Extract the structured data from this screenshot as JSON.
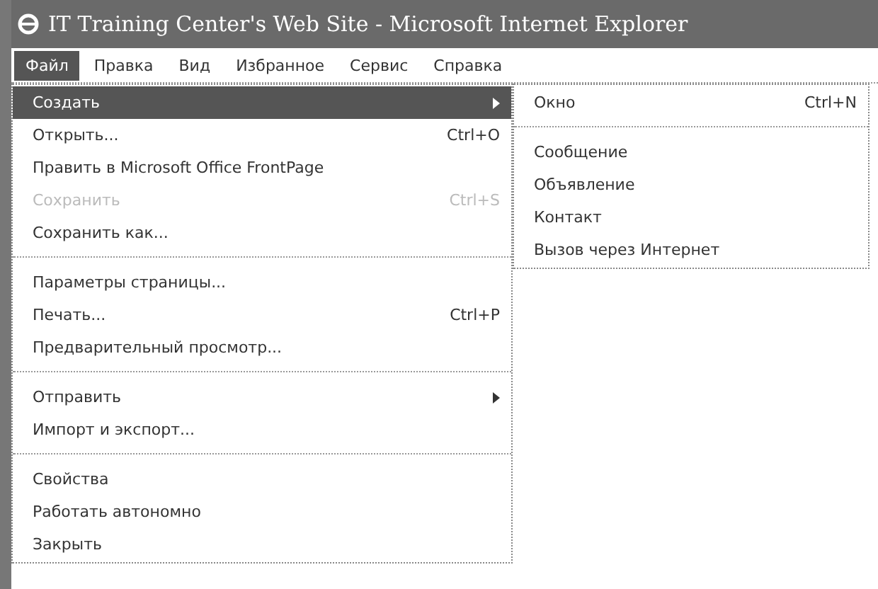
{
  "window": {
    "title": "IT Training Center's Web Site - Microsoft Internet Explorer"
  },
  "menu_bar": [
    {
      "label": "Файл",
      "selected": true
    },
    {
      "label": "Правка",
      "selected": false
    },
    {
      "label": "Вид",
      "selected": false
    },
    {
      "label": "Избранное",
      "selected": false
    },
    {
      "label": "Сервис",
      "selected": false
    },
    {
      "label": "Справка",
      "selected": false
    }
  ],
  "file_menu": [
    {
      "kind": "item",
      "label": "Создать",
      "selected": true,
      "disabled": false,
      "submenu": true
    },
    {
      "kind": "item",
      "label": "Открыть...",
      "shortcut": "Ctrl+O",
      "selected": false,
      "disabled": false,
      "submenu": false
    },
    {
      "kind": "item",
      "label": "Править в Microsoft Office FrontPage",
      "selected": false,
      "disabled": false,
      "submenu": false
    },
    {
      "kind": "item",
      "label": "Сохранить",
      "shortcut": "Ctrl+S",
      "selected": false,
      "disabled": true,
      "submenu": false
    },
    {
      "kind": "item",
      "label": "Сохранить как...",
      "selected": false,
      "disabled": false,
      "submenu": false
    },
    {
      "kind": "separator"
    },
    {
      "kind": "item",
      "label": "Параметры страницы...",
      "selected": false,
      "disabled": false,
      "submenu": false
    },
    {
      "kind": "item",
      "label": "Печать...",
      "shortcut": "Ctrl+P",
      "selected": false,
      "disabled": false,
      "submenu": false
    },
    {
      "kind": "item",
      "label": "Предварительный просмотр...",
      "selected": false,
      "disabled": false,
      "submenu": false
    },
    {
      "kind": "separator"
    },
    {
      "kind": "item",
      "label": "Отправить",
      "selected": false,
      "disabled": false,
      "submenu": true
    },
    {
      "kind": "item",
      "label": "Импорт и экспорт...",
      "selected": false,
      "disabled": false,
      "submenu": false
    },
    {
      "kind": "separator"
    },
    {
      "kind": "item",
      "label": "Свойства",
      "selected": false,
      "disabled": false,
      "submenu": false
    },
    {
      "kind": "item",
      "label": "Работать автономно",
      "selected": false,
      "disabled": false,
      "submenu": false
    },
    {
      "kind": "item",
      "label": "Закрыть",
      "selected": false,
      "disabled": false,
      "submenu": false
    }
  ],
  "new_submenu": [
    {
      "kind": "item",
      "label": "Окно",
      "shortcut": "Ctrl+N",
      "selected": false,
      "disabled": false,
      "submenu": false
    },
    {
      "kind": "separator"
    },
    {
      "kind": "item",
      "label": "Сообщение",
      "selected": false,
      "disabled": false,
      "submenu": false
    },
    {
      "kind": "item",
      "label": "Объявление",
      "selected": false,
      "disabled": false,
      "submenu": false
    },
    {
      "kind": "item",
      "label": "Контакт",
      "selected": false,
      "disabled": false,
      "submenu": false
    },
    {
      "kind": "item",
      "label": "Вызов через Интернет",
      "selected": false,
      "disabled": false,
      "submenu": false
    }
  ]
}
